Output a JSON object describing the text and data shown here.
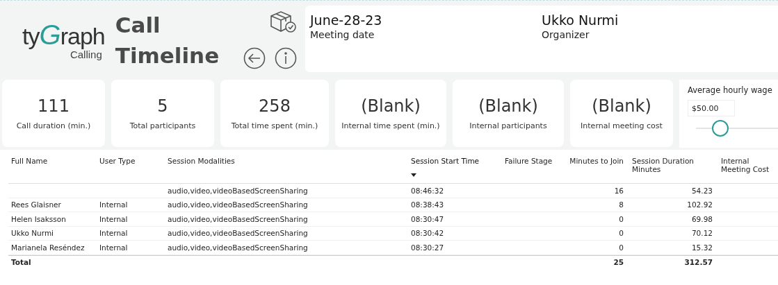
{
  "logo": {
    "parts": [
      "ty",
      "G",
      "raph"
    ],
    "subtitle": "Calling"
  },
  "title": [
    "Call",
    "Timeline"
  ],
  "meeting": [
    {
      "value": "June-28-23",
      "label": "Meeting date"
    },
    {
      "value": "Ukko Nurmi",
      "label": "Organizer"
    }
  ],
  "kpis": [
    {
      "value": "111",
      "label": "Call duration (min.)"
    },
    {
      "value": "5",
      "label": "Total participants"
    },
    {
      "value": "258",
      "label": "Total time spent (min.)"
    },
    {
      "value": "(Blank)",
      "label": "Internal time spent (min.)"
    },
    {
      "value": "(Blank)",
      "label": "Internal participants"
    },
    {
      "value": "(Blank)",
      "label": "Internal meeting cost"
    }
  ],
  "wage": {
    "label": "Average hourly wage",
    "value": "$50.00",
    "level": 0.3
  },
  "table": {
    "columns": [
      {
        "label": "Full Name",
        "sorted": false
      },
      {
        "label": "User Type",
        "sorted": false
      },
      {
        "label": "Session Modalities",
        "sorted": false
      },
      {
        "label": "Session Start Time",
        "sorted": true
      },
      {
        "label": "Failure Stage",
        "sorted": false
      },
      {
        "label": "Minutes to Join",
        "sorted": false
      },
      {
        "label": "Session Duration Minutes",
        "sorted": false
      },
      {
        "label": "Internal Meeting Cost",
        "sorted": false
      }
    ],
    "rows": [
      {
        "modalities": "audio,video,videoBasedScreenSharing",
        "start_time": "08:46:32",
        "minutes_to_join": "16",
        "duration": "54.23"
      },
      {
        "name": "Rees Glaisner",
        "user_type": "Internal",
        "modalities": "audio,video,videoBasedScreenSharing",
        "start_time": "08:38:43",
        "minutes_to_join": "8",
        "duration": "102.92"
      },
      {
        "name": "Helen Isaksson",
        "user_type": "Internal",
        "modalities": "audio,video,videoBasedScreenSharing",
        "start_time": "08:30:47",
        "minutes_to_join": "0",
        "duration": "69.98"
      },
      {
        "name": "Ukko Nurmi",
        "user_type": "Internal",
        "modalities": "audio,video,videoBasedScreenSharing",
        "start_time": "08:30:42",
        "minutes_to_join": "0",
        "duration": "70.12"
      },
      {
        "name": "Marianela Reséndez",
        "user_type": "Internal",
        "modalities": "audio,video,videoBasedScreenSharing",
        "start_time": "08:30:27",
        "minutes_to_join": "0",
        "duration": "15.32"
      }
    ],
    "total": {
      "name": "Total",
      "minutes_to_join": "25",
      "duration": "312.57"
    }
  }
}
